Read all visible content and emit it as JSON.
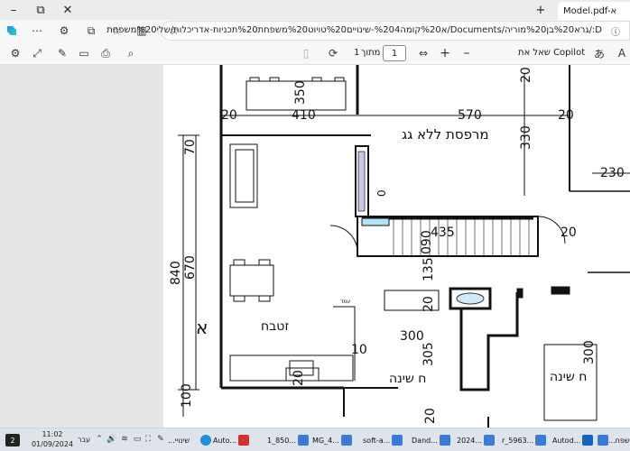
{
  "window": {
    "tab_title": "Model.pdf-א",
    "new_tab": "+",
    "minimize": "–"
  },
  "address": {
    "url": "D:/גרא%20בן%20מוריה/Documents/א%20קומה%204-שינויים%20טויוט%20משפחת%20תכניות-אדריכלות/שלי%20משפחת"
  },
  "pdf_toolbar": {
    "copilot_label": "שאל את Copilot",
    "page_current": "1",
    "page_sep": "מתוך",
    "page_total": "1",
    "zoom_out": "–",
    "zoom_in": "+"
  },
  "drawing": {
    "labels": {
      "roof_balcony": "מרפסת ללא גג",
      "kitchen": "זטבח",
      "bedroom_left": "ח שינה",
      "bedroom_right": "ח שינה",
      "letter_a": "א",
      "small_label": "עמד"
    },
    "dims": {
      "d350": "350",
      "d20a": "20",
      "d410": "410",
      "d570": "570",
      "d20b": "20",
      "d20c": "20",
      "d330": "330",
      "d70": "70",
      "d230": "230",
      "d0": "0",
      "d435": "435",
      "d090": "090",
      "d20d": "20",
      "d840": "840",
      "d670": "670",
      "d135": "135",
      "d20e": "20",
      "d300": "300",
      "d10": "10",
      "d305": "305",
      "d300b": "300",
      "d100": "100",
      "d20f": "20",
      "d20g": "20"
    }
  },
  "taskbar": {
    "time": "11:02",
    "date": "01/09/2024",
    "lang": "עבר",
    "notif": "2",
    "apps": [
      "...שינויי",
      "Auto...",
      "1_850...",
      "MG_4...",
      "soft-a...",
      "Dand...",
      "2024...",
      "r_5963...",
      "Autod...",
      "...משפח"
    ]
  }
}
